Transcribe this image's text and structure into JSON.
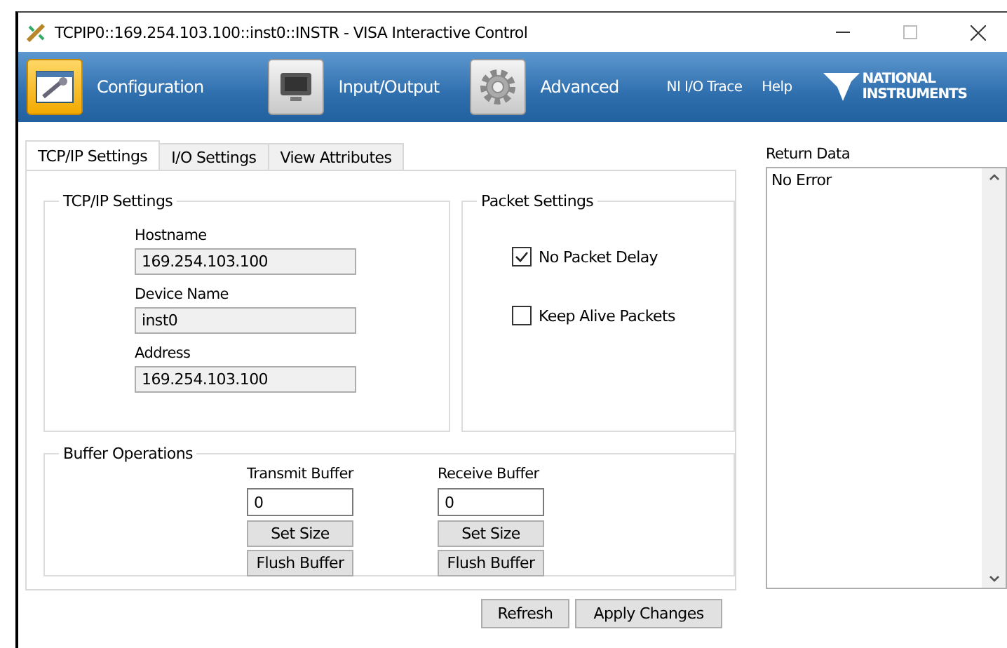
{
  "window": {
    "title": "TCPIP0::169.254.103.100::inst0::INSTR - VISA Interactive Control"
  },
  "toolbar": {
    "items": [
      {
        "label": "Configuration",
        "selected": true,
        "kind": "config"
      },
      {
        "label": "Input/Output",
        "selected": false,
        "kind": "io"
      },
      {
        "label": "Advanced",
        "selected": false,
        "kind": "gear"
      }
    ],
    "links": [
      "NI I/O Trace",
      "Help"
    ],
    "logo": [
      "NATIONAL",
      "INSTRUMENTS"
    ]
  },
  "tabs": [
    {
      "label": "TCP/IP Settings",
      "selected": true
    },
    {
      "label": "I/O Settings",
      "selected": false
    },
    {
      "label": "View Attributes",
      "selected": false
    }
  ],
  "tcpip_settings": {
    "title": "TCP/IP Settings",
    "fields": [
      {
        "label": "Hostname",
        "value": "169.254.103.100"
      },
      {
        "label": "Device Name",
        "value": "inst0"
      },
      {
        "label": "Address",
        "value": "169.254.103.100"
      }
    ]
  },
  "packet_settings": {
    "title": "Packet Settings",
    "options": [
      {
        "label": "No Packet Delay",
        "checked": true
      },
      {
        "label": "Keep Alive Packets",
        "checked": false
      }
    ]
  },
  "buffer_operations": {
    "title": "Buffer Operations",
    "buffers": [
      {
        "label": "Transmit Buffer",
        "value": "0",
        "buttons": [
          "Set Size",
          "Flush Buffer"
        ]
      },
      {
        "label": "Receive Buffer",
        "value": "0",
        "buttons": [
          "Set Size",
          "Flush Buffer"
        ]
      }
    ]
  },
  "return_data": {
    "label": "Return Data",
    "text": "No Error"
  },
  "buttons": [
    "Refresh",
    "Apply Changes"
  ]
}
